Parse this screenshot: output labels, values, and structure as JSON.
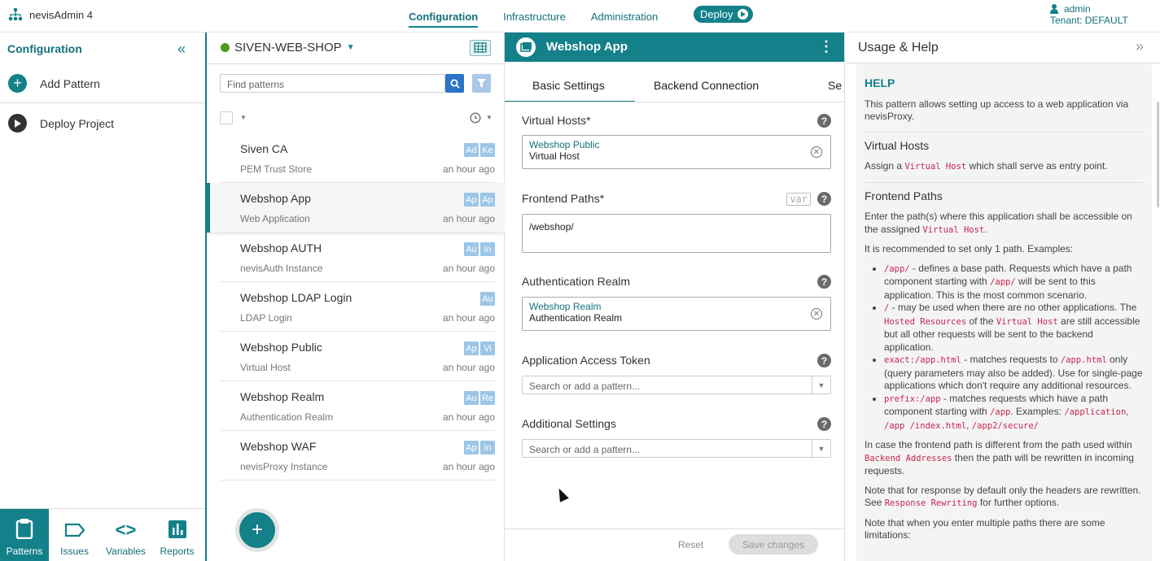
{
  "app": {
    "name": "nevisAdmin 4"
  },
  "nav": {
    "tabs": [
      "Configuration",
      "Infrastructure",
      "Administration"
    ],
    "deploy_label": "Deploy"
  },
  "user": {
    "name": "admin",
    "tenant": "Tenant: DEFAULT"
  },
  "left": {
    "title": "Configuration",
    "add_pattern": "Add Pattern",
    "deploy_project": "Deploy Project",
    "bottom": [
      "Patterns",
      "Issues",
      "Variables",
      "Reports"
    ]
  },
  "project": {
    "name": "SIVEN-WEB-SHOP",
    "search_placeholder": "Find patterns",
    "items": [
      {
        "name": "Siven CA",
        "type": "PEM Trust Store",
        "time": "an hour ago",
        "badges": [
          "Ad",
          "Ke"
        ]
      },
      {
        "name": "Webshop App",
        "type": "Web Application",
        "time": "an hour ago",
        "badges": [
          "Ap",
          "Ap"
        ]
      },
      {
        "name": "Webshop AUTH",
        "type": "nevisAuth Instance",
        "time": "an hour ago",
        "badges": [
          "Au",
          "In"
        ]
      },
      {
        "name": "Webshop LDAP Login",
        "type": "LDAP Login",
        "time": "an hour ago",
        "badges": [
          "Au"
        ]
      },
      {
        "name": "Webshop Public",
        "type": "Virtual Host",
        "time": "an hour ago",
        "badges": [
          "Ap",
          "Vi"
        ]
      },
      {
        "name": "Webshop Realm",
        "type": "Authentication Realm",
        "time": "an hour ago",
        "badges": [
          "Au",
          "Re"
        ]
      },
      {
        "name": "Webshop WAF",
        "type": "nevisProxy Instance",
        "time": "an hour ago",
        "badges": [
          "Ap",
          "In"
        ]
      }
    ]
  },
  "editor": {
    "title": "Webshop App",
    "tabs": [
      "Basic Settings",
      "Backend Connection",
      "Se"
    ],
    "virtual_hosts": {
      "label": "Virtual Hosts*",
      "chip_name": "Webshop Public",
      "chip_type": "Virtual Host"
    },
    "frontend_paths": {
      "label": "Frontend Paths*",
      "var": "var",
      "value": "/webshop/"
    },
    "auth_realm": {
      "label": "Authentication Realm",
      "chip_name": "Webshop Realm",
      "chip_type": "Authentication Realm"
    },
    "access_token": {
      "label": "Application Access Token",
      "placeholder": "Search or add a pattern..."
    },
    "additional": {
      "label": "Additional Settings",
      "placeholder": "Search or add a pattern..."
    },
    "reset": "Reset",
    "save": "Save changes"
  },
  "help": {
    "title": "Usage & Help",
    "heading": "HELP",
    "intro": "This pattern allows setting up access to a web application via nevisProxy.",
    "vh_title": "Virtual Hosts",
    "vh_pre": "Assign a ",
    "vh_code": "Virtual Host",
    "vh_post": " which shall serve as entry point.",
    "fp_title": "Frontend Paths",
    "fp_p1_pre": "Enter the path(s) where this application shall be accessible on the assigned ",
    "fp_p1_code": "Virtual Host",
    "fp_p1_post": ".",
    "fp_p2": "It is recommended to set only 1 path. Examples:",
    "li1_code": "/app/",
    "li1_a": " - defines a base path. Requests which have a path component starting with ",
    "li1_code2": "/app/",
    "li1_b": " will be sent to this application. This is the most common scenario.",
    "li2_code": "/",
    "li2_a": " - may be used when there are no other applications. The ",
    "li2_code2": "Hosted Resources",
    "li2_b": " of the ",
    "li2_code3": "Virtual Host",
    "li2_c": " are still accessible but all other requests will be sent to the backend application.",
    "li3_code": "exact:/app.html",
    "li3_a": " - matches requests to ",
    "li3_code2": "/app.html",
    "li3_b": " only (query parameters may also be added). Use for single-page applications which don't require any additional resources.",
    "li4_code": "prefix:/app",
    "li4_a": " - matches requests which have a path component starting with ",
    "li4_code2": "/app",
    "li4_b": ". Examples: ",
    "li4_code3": "/application",
    "li4_c": ", ",
    "li4_code4": "/app /index.html",
    "li4_d": ", ",
    "li4_code5": "/app2/secure/",
    "p3_pre": "In case the frontend path is different from the path used within ",
    "p3_code": "Backend Addresses",
    "p3_post": " then the path will be rewritten in incoming requests.",
    "p4_pre": "Note that for response by default only the headers are rewritten. See ",
    "p4_code": "Response Rewriting",
    "p4_post": " for further options.",
    "p5": "Note that when you enter multiple paths there are some limitations:"
  },
  "colors": {
    "accent": "#13808a",
    "badge": "#9bc6e8",
    "code": "#c7254e"
  }
}
